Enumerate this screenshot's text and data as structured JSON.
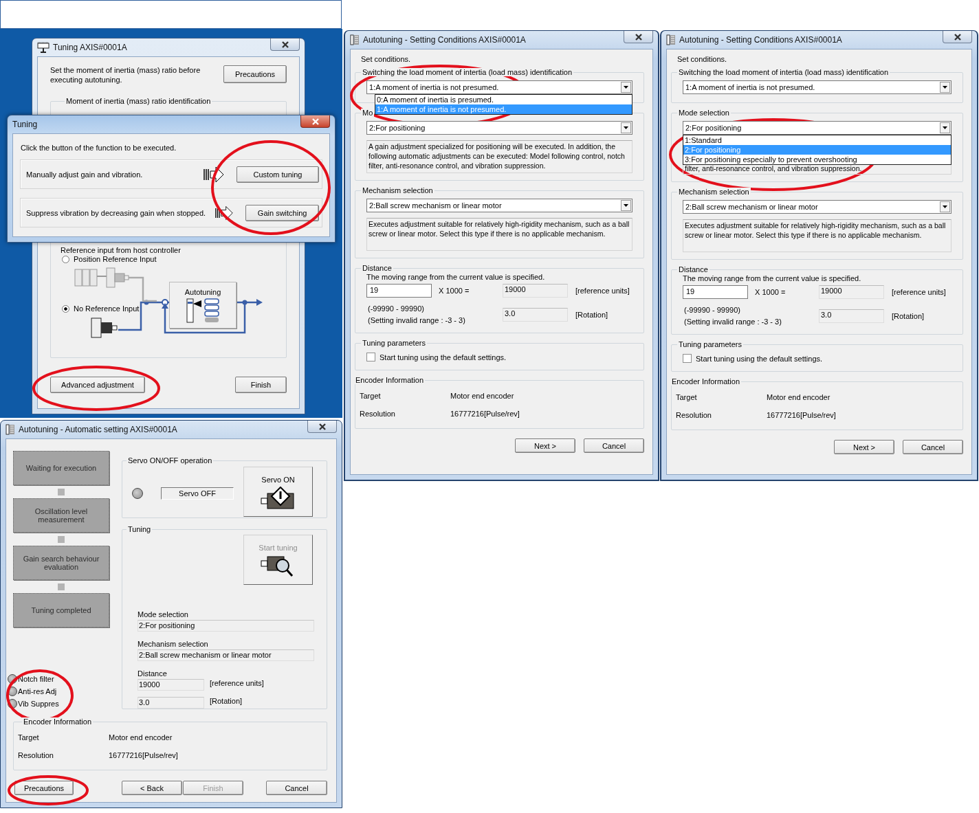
{
  "tuning_window": {
    "title": "Tuning AXIS#0001A",
    "intro": "Set the moment of inertia (mass) ratio before executing autotuning.",
    "precautions_button": "Precautions",
    "inertia_group": "Moment of inertia (mass) ratio identification",
    "reference_label": "Reference input from host controller",
    "options": [
      {
        "label": "Position Reference Input",
        "selected": false
      },
      {
        "label": "No Reference Input",
        "selected": true
      }
    ],
    "diagram_label": "Autotuning",
    "buttons": [
      "Advanced adjustment",
      "Finish"
    ]
  },
  "function_dialog": {
    "title": "Tuning",
    "prompt": "Click the button of the function to be executed.",
    "rows": [
      {
        "description": "Manually adjust gain and vibration.",
        "button": "Custom tuning"
      },
      {
        "description": "Suppress vibration by decreasing gain when stopped.",
        "button": "Gain switching"
      }
    ]
  },
  "setting_windows": [
    {
      "title": "Autotuning - Setting Conditions AXIS#0001A",
      "intro": "Set conditions.",
      "identification": {
        "legend": "Switching the load moment of intertia (load mass) identification",
        "value": "1:A moment of inertia is not presumed.",
        "open": true,
        "options": [
          {
            "label": "0:A moment of inertia is presumed.",
            "selected": false
          },
          {
            "label": "1:A moment of inertia is not presumed.",
            "selected": true
          }
        ]
      },
      "mode": {
        "legend": "Mo",
        "value": "2:For positioning",
        "open": false,
        "description": "A gain adjustment specialized for positioning will be executed. In addition, the following automatic adjustments can be executed: Model following control, notch filter, anti-resonance control, and vibration suppression."
      },
      "mechanism": {
        "legend": "Mechanism selection",
        "value": "2:Ball screw mechanism or linear motor",
        "description": "Executes adjustment suitable for relatively high-rigidity mechanism, such as a ball screw or linear motor. Select this type if there is no applicable mechanism."
      },
      "distance": {
        "legend": "Distance",
        "note": "The moving range from the current value is specified.",
        "input": "19",
        "multiplier": "X 1000 =",
        "result": "19000",
        "result_unit": "[reference units]",
        "range": "(-99990 - 99990)",
        "invalid_range": "(Setting invalid range : -3 - 3)",
        "rotation": "3.0",
        "rotation_unit": "[Rotation]"
      },
      "tuning_parameters": {
        "legend": "Tuning parameters",
        "label": "Start tuning using the default settings.",
        "checked": false
      },
      "encoder": {
        "legend": "Encoder Information",
        "rows": [
          {
            "label": "Target",
            "value": "Motor end encoder"
          },
          {
            "label": "Resolution",
            "value": "16777216[Pulse/rev]"
          }
        ]
      },
      "buttons": [
        "Next >",
        "Cancel"
      ]
    },
    {
      "title": "Autotuning - Setting Conditions AXIS#0001A",
      "intro": "Set conditions.",
      "identification": {
        "legend": "Switching the load moment of intertia (load mass) identification",
        "value": "1:A moment of inertia is not presumed.",
        "open": false
      },
      "mode": {
        "legend": "Mode selection",
        "value": "2:For positioning",
        "open": true,
        "options": [
          {
            "label": "1:Standard",
            "selected": false
          },
          {
            "label": "2:For positioning",
            "selected": true
          },
          {
            "label": "3:For positioning especially to prevent overshooting",
            "selected": false
          }
        ],
        "description": "filter, anti-resonance control, and vibration suppression."
      },
      "mechanism": {
        "legend": "Mechanism selection",
        "value": "2:Ball screw mechanism or linear motor",
        "description": "Executes adjustment suitable for relatively high-rigidity mechanism, such as a ball screw or linear motor. Select this type if there is no applicable mechanism."
      },
      "distance": {
        "legend": "Distance",
        "note": "The moving range from the current value is specified.",
        "input": "19",
        "multiplier": "X 1000 =",
        "result": "19000",
        "result_unit": "[reference units]",
        "range": "(-99990 - 99990)",
        "invalid_range": "(Setting invalid range : -3 - 3)",
        "rotation": "3.0",
        "rotation_unit": "[Rotation]"
      },
      "tuning_parameters": {
        "legend": "Tuning parameters",
        "label": "Start tuning using the default settings.",
        "checked": false
      },
      "encoder": {
        "legend": "Encoder Information",
        "rows": [
          {
            "label": "Target",
            "value": "Motor end encoder"
          },
          {
            "label": "Resolution",
            "value": "16777216[Pulse/rev]"
          }
        ]
      },
      "buttons": [
        "Next >",
        "Cancel"
      ]
    }
  ],
  "auto_window": {
    "title": "Autotuning - Automatic setting AXIS#0001A",
    "steps": [
      "Waiting for execution",
      "Oscillation level measurement",
      "Gain search behaviour evaluation",
      "Tuning completed"
    ],
    "indicators": [
      {
        "label": "Notch filter",
        "on": false
      },
      {
        "label": "Anti-res Adj",
        "on": false
      },
      {
        "label": "Vib Suppres",
        "on": false
      }
    ],
    "servo": {
      "legend": "Servo ON/OFF operation",
      "lamp_on": false,
      "status": "Servo OFF",
      "button": "Servo ON"
    },
    "tuning": {
      "legend": "Tuning",
      "start_button": "Start tuning",
      "start_disabled": true,
      "mode_label": "Mode selection",
      "mode_value": "2:For positioning",
      "mechanism_label": "Mechanism selection",
      "mechanism_value": "2:Ball screw mechanism or linear motor",
      "distance_label": "Distance",
      "distance_value": "19000",
      "distance_unit": "[reference units]",
      "rotation_value": "3.0",
      "rotation_unit": "[Rotation]"
    },
    "encoder": {
      "legend": "Encoder Information",
      "rows": [
        {
          "label": "Target",
          "value": "Motor end encoder"
        },
        {
          "label": "Resolution",
          "value": "16777216[Pulse/rev]"
        }
      ]
    },
    "buttons": [
      {
        "label": "Precautions",
        "disabled": false
      },
      {
        "label": "< Back",
        "disabled": false
      },
      {
        "label": "Finish",
        "disabled": true
      },
      {
        "label": "Cancel",
        "disabled": false
      }
    ]
  }
}
